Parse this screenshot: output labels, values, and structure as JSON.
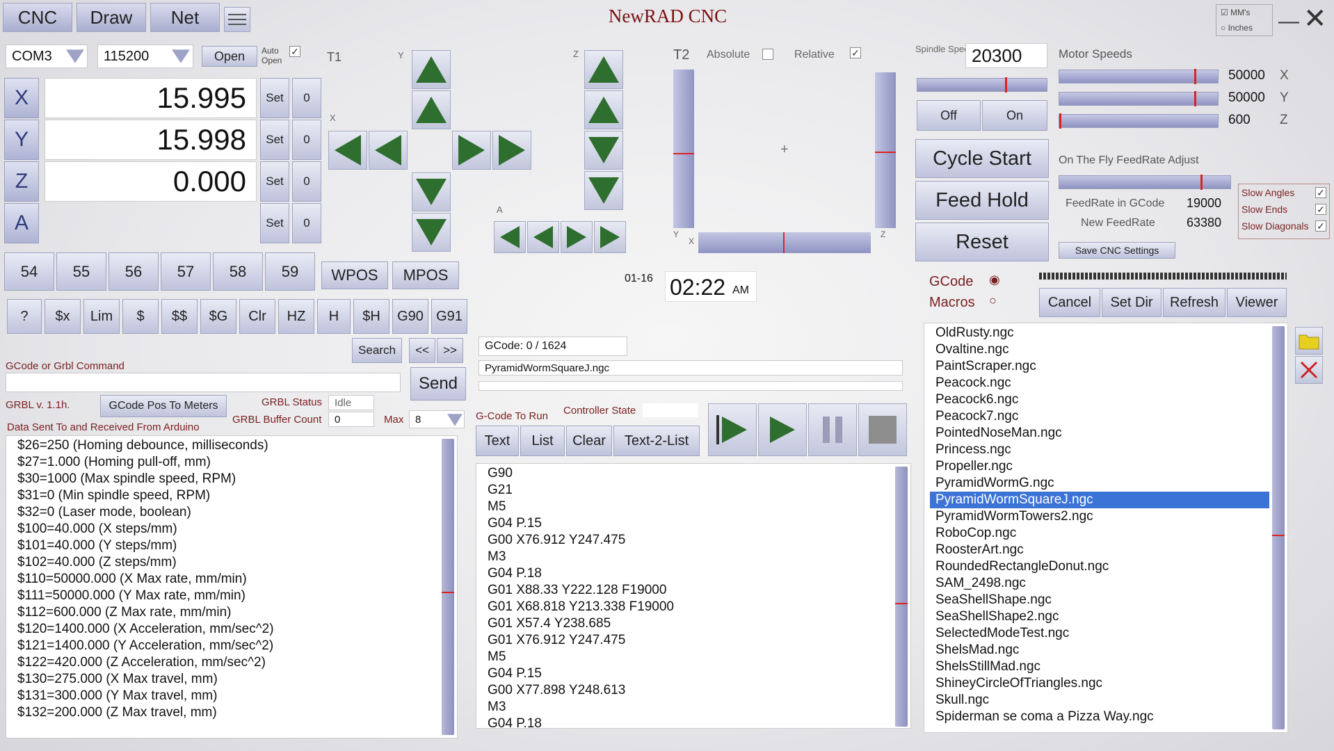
{
  "app": {
    "title": "NewRAD CNC",
    "tabs": [
      "CNC",
      "Draw",
      "Net"
    ],
    "units": {
      "mm": "MM's",
      "inches": "Inches"
    }
  },
  "conn": {
    "port": "COM3",
    "baud": "115200",
    "open": "Open",
    "auto_open": "Auto Open"
  },
  "axes": [
    {
      "name": "X",
      "value": "15.995"
    },
    {
      "name": "Y",
      "value": "15.998"
    },
    {
      "name": "Z",
      "value": "0.000"
    },
    {
      "name": "A",
      "value": ""
    }
  ],
  "set_label": "Set",
  "zero_label": "0",
  "wcs": [
    "54",
    "55",
    "56",
    "57",
    "58",
    "59"
  ],
  "pos_modes": [
    "WPOS",
    "MPOS"
  ],
  "cmds": [
    "?",
    "$x",
    "Lim",
    "$",
    "$$",
    "$G",
    "Clr",
    "HZ",
    "H",
    "$H",
    "G90",
    "G91"
  ],
  "jog": {
    "t1": "T1",
    "y": "Y",
    "x": "X",
    "z": "Z",
    "a": "A"
  },
  "t2": {
    "label": "T2",
    "absolute": "Absolute",
    "relative": "Relative",
    "y": "Y",
    "x": "X",
    "z": "Z"
  },
  "spindle": {
    "label": "Spindle Speed",
    "value": "20300",
    "off": "Off",
    "on": "On"
  },
  "motor": {
    "label": "Motor Speeds",
    "rows": [
      {
        "v": "50000",
        "ax": "X",
        "pos": 0.86
      },
      {
        "v": "50000",
        "ax": "Y",
        "pos": 0.86
      },
      {
        "v": "600",
        "ax": "Z",
        "pos": 0.0
      }
    ]
  },
  "control": {
    "cycle_start": "Cycle Start",
    "feed_hold": "Feed Hold",
    "reset": "Reset"
  },
  "feed": {
    "title": "On The Fly FeedRate Adjust",
    "gcode_label": "FeedRate in GCode",
    "gcode_value": "19000",
    "new_label": "New FeedRate",
    "new_value": "63380",
    "save": "Save CNC Settings",
    "pos": 0.83
  },
  "slow": [
    {
      "label": "Slow Angles"
    },
    {
      "label": "Slow Ends"
    },
    {
      "label": "Slow Diagonals"
    }
  ],
  "search": {
    "label": "Search",
    "prev": "<<",
    "next": ">>"
  },
  "command": {
    "label": "GCode or Grbl Command",
    "send": "Send"
  },
  "grbl": {
    "version": "GRBL v. 1.1h.",
    "to_meters": "GCode Pos To Meters",
    "status_label": "GRBL Status",
    "status": "Idle",
    "buffer_label": "GRBL Buffer Count",
    "buffer": "0",
    "max_label": "Max",
    "max": "8"
  },
  "data_label": "Data Sent To and Received From Arduino",
  "console": [
    "$26=250 (Homing debounce, milliseconds)",
    "$27=1.000 (Homing pull-off, mm)",
    "$30=1000 (Max spindle speed, RPM)",
    "$31=0 (Min spindle speed, RPM)",
    "$32=0 (Laser mode, boolean)",
    "$100=40.000 (X steps/mm)",
    "$101=40.000 (Y steps/mm)",
    "$102=40.000 (Z steps/mm)",
    "$110=50000.000 (X Max rate, mm/min)",
    "$111=50000.000 (Y Max rate, mm/min)",
    "$112=600.000 (Z Max rate, mm/min)",
    "$120=1400.000 (X Acceleration, mm/sec^2)",
    "$121=1400.000 (Y Acceleration, mm/sec^2)",
    "$122=420.000 (Z Acceleration, mm/sec^2)",
    "$130=275.000 (X Max travel, mm)",
    "$131=300.000 (Y Max travel, mm)",
    "$132=200.000 (Z Max travel, mm)"
  ],
  "clock": {
    "date": "01-16",
    "time": "02:22",
    "ampm": "AM"
  },
  "gcode": {
    "progress": "GCode: 0 / 1624",
    "file": "PyramidWormSquareJ.ngc",
    "to_run": "G-Code To Run",
    "ctrl_state": "Controller State",
    "btns": [
      "Text",
      "List",
      "Clear",
      "Text-2-List"
    ],
    "lines": [
      "G90",
      "G21",
      "M5",
      "G04 P.15",
      "G00 X76.912 Y247.475",
      "M3",
      "G04 P.18",
      "G01 X88.33 Y222.128 F19000",
      "G01 X68.818 Y213.338 F19000",
      "G01 X57.4 Y238.685",
      "G01 X76.912 Y247.475",
      "M5",
      "G04 P.15",
      "G00 X77.898 Y248.613",
      "M3",
      "G04 P.18"
    ]
  },
  "files": {
    "gcode": "GCode",
    "macros": "Macros",
    "btns": [
      "Cancel",
      "Set Dir",
      "Refresh",
      "Viewer"
    ],
    "items": [
      "OldRusty.ngc",
      "Ovaltine.ngc",
      "PaintScraper.ngc",
      "Peacock.ngc",
      "Peacock6.ngc",
      "Peacock7.ngc",
      "PointedNoseMan.ngc",
      "Princess.ngc",
      "Propeller.ngc",
      "PyramidWormG.ngc",
      "PyramidWormSquareJ.ngc",
      "PyramidWormTowers2.ngc",
      "RoboCop.ngc",
      "RoosterArt.ngc",
      "RoundedRectangleDonut.ngc",
      "SAM_2498.ngc",
      "SeaShellShape.ngc",
      "SeaShellShape2.ngc",
      "SelectedModeTest.ngc",
      "ShelsMad.ngc",
      "ShelsStillMad.ngc",
      "ShineyCircleOfTriangles.ngc",
      "Skull.ngc",
      "Spiderman se coma a Pizza Way.ngc"
    ],
    "selected": 10
  },
  "colors": {
    "accent": "#2e6e2e",
    "selection": "#3b73d6",
    "title": "#7a1010"
  }
}
